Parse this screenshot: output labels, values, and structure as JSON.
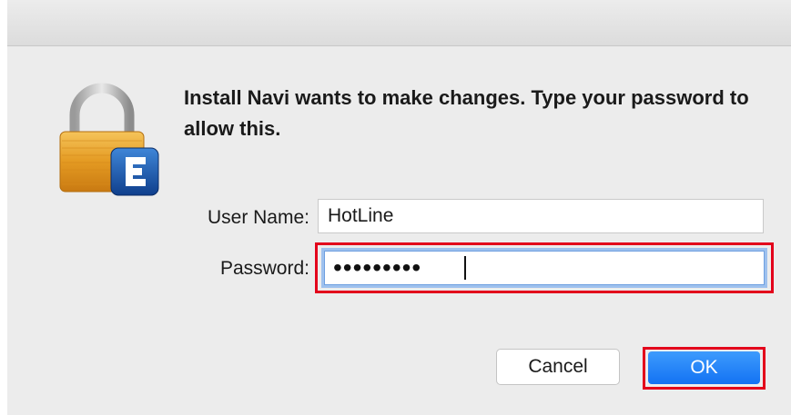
{
  "dialog": {
    "message": "Install Navi wants to make changes. Type your password to allow this.",
    "icon": "padlock-with-app-badge-icon"
  },
  "form": {
    "username_label": "User Name:",
    "username_value": "HotLine",
    "password_label": "Password:",
    "password_masked": "•••••••••"
  },
  "buttons": {
    "cancel_label": "Cancel",
    "ok_label": "OK"
  },
  "colors": {
    "highlight": "#e3001b",
    "ok_button": "#1a7bf7",
    "focus_ring": "#9ec1ee",
    "dialog_background": "#ececec"
  }
}
